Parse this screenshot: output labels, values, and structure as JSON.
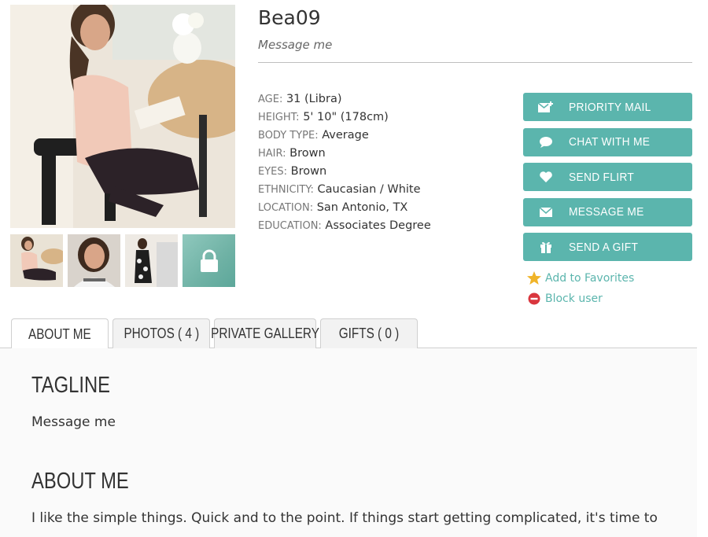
{
  "profile": {
    "username": "Bea09",
    "tagline": "Message me"
  },
  "details": [
    {
      "label": "AGE:",
      "value": "31 (Libra)"
    },
    {
      "label": "HEIGHT:",
      "value": "5' 10\" (178cm)"
    },
    {
      "label": "BODY TYPE:",
      "value": "Average"
    },
    {
      "label": "HAIR:",
      "value": "Brown"
    },
    {
      "label": "EYES:",
      "value": "Brown"
    },
    {
      "label": "ETHNICITY:",
      "value": "Caucasian / White"
    },
    {
      "label": "LOCATION:",
      "value": "San Antonio, TX"
    },
    {
      "label": "EDUCATION:",
      "value": "Associates Degree"
    }
  ],
  "actions": {
    "priority_mail": "PRIORITY MAIL",
    "chat": "CHAT WITH ME",
    "flirt": "SEND FLIRT",
    "message": "MESSAGE ME",
    "gift": "SEND A GIFT",
    "favorites": "Add to Favorites",
    "block": "Block user"
  },
  "tabs": [
    "ABOUT ME",
    "PHOTOS ( 4 )",
    "PRIVATE GALLERY",
    "GIFTS ( 0 )"
  ],
  "sections": {
    "tagline_title": "TAGLINE",
    "tagline_text": "Message me",
    "about_title": "ABOUT ME",
    "about_text": "I like the simple things. Quick and to the point. If things start getting complicated, it's time to"
  },
  "colors": {
    "accent": "#5bb5ad",
    "star": "#f0b429",
    "block": "#d9363e"
  }
}
